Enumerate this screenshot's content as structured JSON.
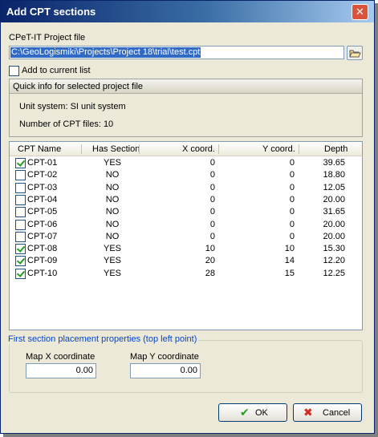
{
  "window": {
    "title": "Add CPT sections",
    "close_glyph": "✕"
  },
  "project_file": {
    "label": "CPeT-IT Project file",
    "path": "C:\\GeoLogismiki\\Projects\\Project 18\\trial\\test.cpt"
  },
  "add_to_list": {
    "label": "Add to current list",
    "checked": false
  },
  "quick_info": {
    "title": "Quick info for selected project file",
    "unit_system": "Unit system: SI unit system",
    "cpt_count": "Number of CPT files: 10"
  },
  "table": {
    "columns": [
      "CPT Name",
      "Has Section",
      "X coord.",
      "Y coord.",
      "Depth"
    ],
    "rows": [
      {
        "checked": true,
        "name": "CPT-01",
        "has_section": "YES",
        "x": "0",
        "y": "0",
        "depth": "39.65"
      },
      {
        "checked": false,
        "name": "CPT-02",
        "has_section": "NO",
        "x": "0",
        "y": "0",
        "depth": "18.80"
      },
      {
        "checked": false,
        "name": "CPT-03",
        "has_section": "NO",
        "x": "0",
        "y": "0",
        "depth": "12.05"
      },
      {
        "checked": false,
        "name": "CPT-04",
        "has_section": "NO",
        "x": "0",
        "y": "0",
        "depth": "20.00"
      },
      {
        "checked": false,
        "name": "CPT-05",
        "has_section": "NO",
        "x": "0",
        "y": "0",
        "depth": "31.65"
      },
      {
        "checked": false,
        "name": "CPT-06",
        "has_section": "NO",
        "x": "0",
        "y": "0",
        "depth": "20.00"
      },
      {
        "checked": false,
        "name": "CPT-07",
        "has_section": "NO",
        "x": "0",
        "y": "0",
        "depth": "20.00"
      },
      {
        "checked": true,
        "name": "CPT-08",
        "has_section": "YES",
        "x": "10",
        "y": "10",
        "depth": "15.30"
      },
      {
        "checked": true,
        "name": "CPT-09",
        "has_section": "YES",
        "x": "20",
        "y": "14",
        "depth": "12.20"
      },
      {
        "checked": true,
        "name": "CPT-10",
        "has_section": "YES",
        "x": "28",
        "y": "15",
        "depth": "12.25"
      }
    ]
  },
  "placement": {
    "title": "First section placement properties (top left point)",
    "map_x_label": "Map X coordinate",
    "map_x_value": "0.00",
    "map_y_label": "Map Y coordinate",
    "map_y_value": "0.00"
  },
  "buttons": {
    "ok_label": "OK",
    "ok_icon": "check-icon",
    "cancel_label": "Cancel",
    "cancel_icon": "x-icon"
  },
  "colors": {
    "title_bar": "#0a246a",
    "selection": "#316ac5",
    "group_title": "#0046d5",
    "ok_icon": "#21a121",
    "cancel_icon": "#d42b1e"
  }
}
